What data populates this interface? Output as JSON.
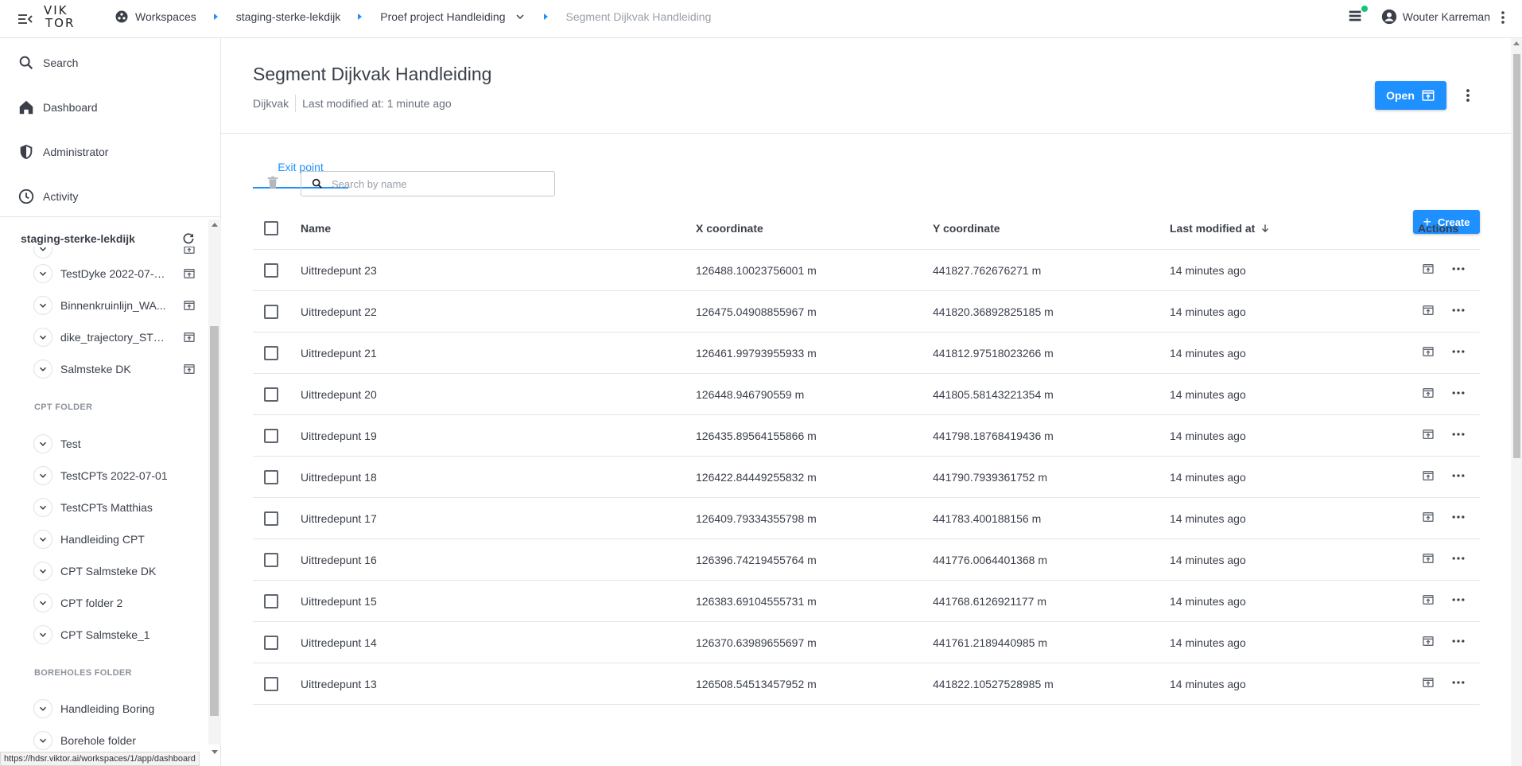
{
  "topbar": {
    "logo_line1": "VIK",
    "logo_line2": "TOR",
    "breadcrumbs": [
      {
        "label": "Workspaces"
      },
      {
        "label": "staging-sterke-lekdijk"
      },
      {
        "label": "Proef project Handleiding"
      },
      {
        "label": "Segment Dijkvak Handleiding"
      }
    ],
    "user_name": "Wouter Karreman"
  },
  "sidebar": {
    "nav": [
      {
        "label": "Search",
        "icon": "search-icon"
      },
      {
        "label": "Dashboard",
        "icon": "home-icon"
      },
      {
        "label": "Administrator",
        "icon": "shield-icon"
      },
      {
        "label": "Activity",
        "icon": "clock-icon"
      }
    ],
    "workspace_name": "staging-sterke-lekdijk",
    "tree_top": [
      {
        "label": "TestDyke 2022-07-0..."
      },
      {
        "label": "Binnenkruinlijn_WA..."
      },
      {
        "label": "dike_trajectory_STE..."
      },
      {
        "label": "Salmsteke DK"
      }
    ],
    "cpt_folder_label": "CPT FOLDER",
    "cpt_items": [
      {
        "label": "Test"
      },
      {
        "label": "TestCPTs 2022-07-01"
      },
      {
        "label": "TestCPTs Matthias"
      },
      {
        "label": "Handleiding CPT"
      },
      {
        "label": "CPT Salmsteke DK"
      },
      {
        "label": "CPT folder 2"
      },
      {
        "label": "CPT Salmsteke_1"
      }
    ],
    "boreholes_folder_label": "BOREHOLES FOLDER",
    "borehole_items": [
      {
        "label": "Handleiding Boring"
      },
      {
        "label": "Borehole folder"
      }
    ]
  },
  "status_url": "https://hdsr.viktor.ai/workspaces/1/app/dashboard",
  "header": {
    "title": "Segment Dijkvak Handleiding",
    "entity_type": "Dijkvak",
    "last_modified": "Last modified at: 1 minute ago",
    "open_label": "Open"
  },
  "tabs": [
    {
      "label": "Exit point"
    }
  ],
  "toolbar": {
    "search_placeholder": "Search by name",
    "create_label": "Create"
  },
  "table": {
    "columns": {
      "name": "Name",
      "x": "X coordinate",
      "y": "Y coordinate",
      "modified": "Last modified at",
      "actions": "Actions"
    },
    "rows": [
      {
        "name": "Uittredepunt 23",
        "x": "126488.10023756001 m",
        "y": "441827.762676271 m",
        "modified": "14 minutes ago"
      },
      {
        "name": "Uittredepunt 22",
        "x": "126475.04908855967 m",
        "y": "441820.36892825185 m",
        "modified": "14 minutes ago"
      },
      {
        "name": "Uittredepunt 21",
        "x": "126461.99793955933 m",
        "y": "441812.97518023266 m",
        "modified": "14 minutes ago"
      },
      {
        "name": "Uittredepunt 20",
        "x": "126448.946790559 m",
        "y": "441805.58143221354 m",
        "modified": "14 minutes ago"
      },
      {
        "name": "Uittredepunt 19",
        "x": "126435.89564155866 m",
        "y": "441798.18768419436 m",
        "modified": "14 minutes ago"
      },
      {
        "name": "Uittredepunt 18",
        "x": "126422.84449255832 m",
        "y": "441790.7939361752 m",
        "modified": "14 minutes ago"
      },
      {
        "name": "Uittredepunt 17",
        "x": "126409.79334355798 m",
        "y": "441783.400188156 m",
        "modified": "14 minutes ago"
      },
      {
        "name": "Uittredepunt 16",
        "x": "126396.74219455764 m",
        "y": "441776.0064401368 m",
        "modified": "14 minutes ago"
      },
      {
        "name": "Uittredepunt 15",
        "x": "126383.69104555731 m",
        "y": "441768.6126921177 m",
        "modified": "14 minutes ago"
      },
      {
        "name": "Uittredepunt 14",
        "x": "126370.63989655697 m",
        "y": "441761.2189440985 m",
        "modified": "14 minutes ago"
      },
      {
        "name": "Uittredepunt 13",
        "x": "126508.54513457952 m",
        "y": "441822.10527528985 m",
        "modified": "14 minutes ago"
      }
    ]
  }
}
